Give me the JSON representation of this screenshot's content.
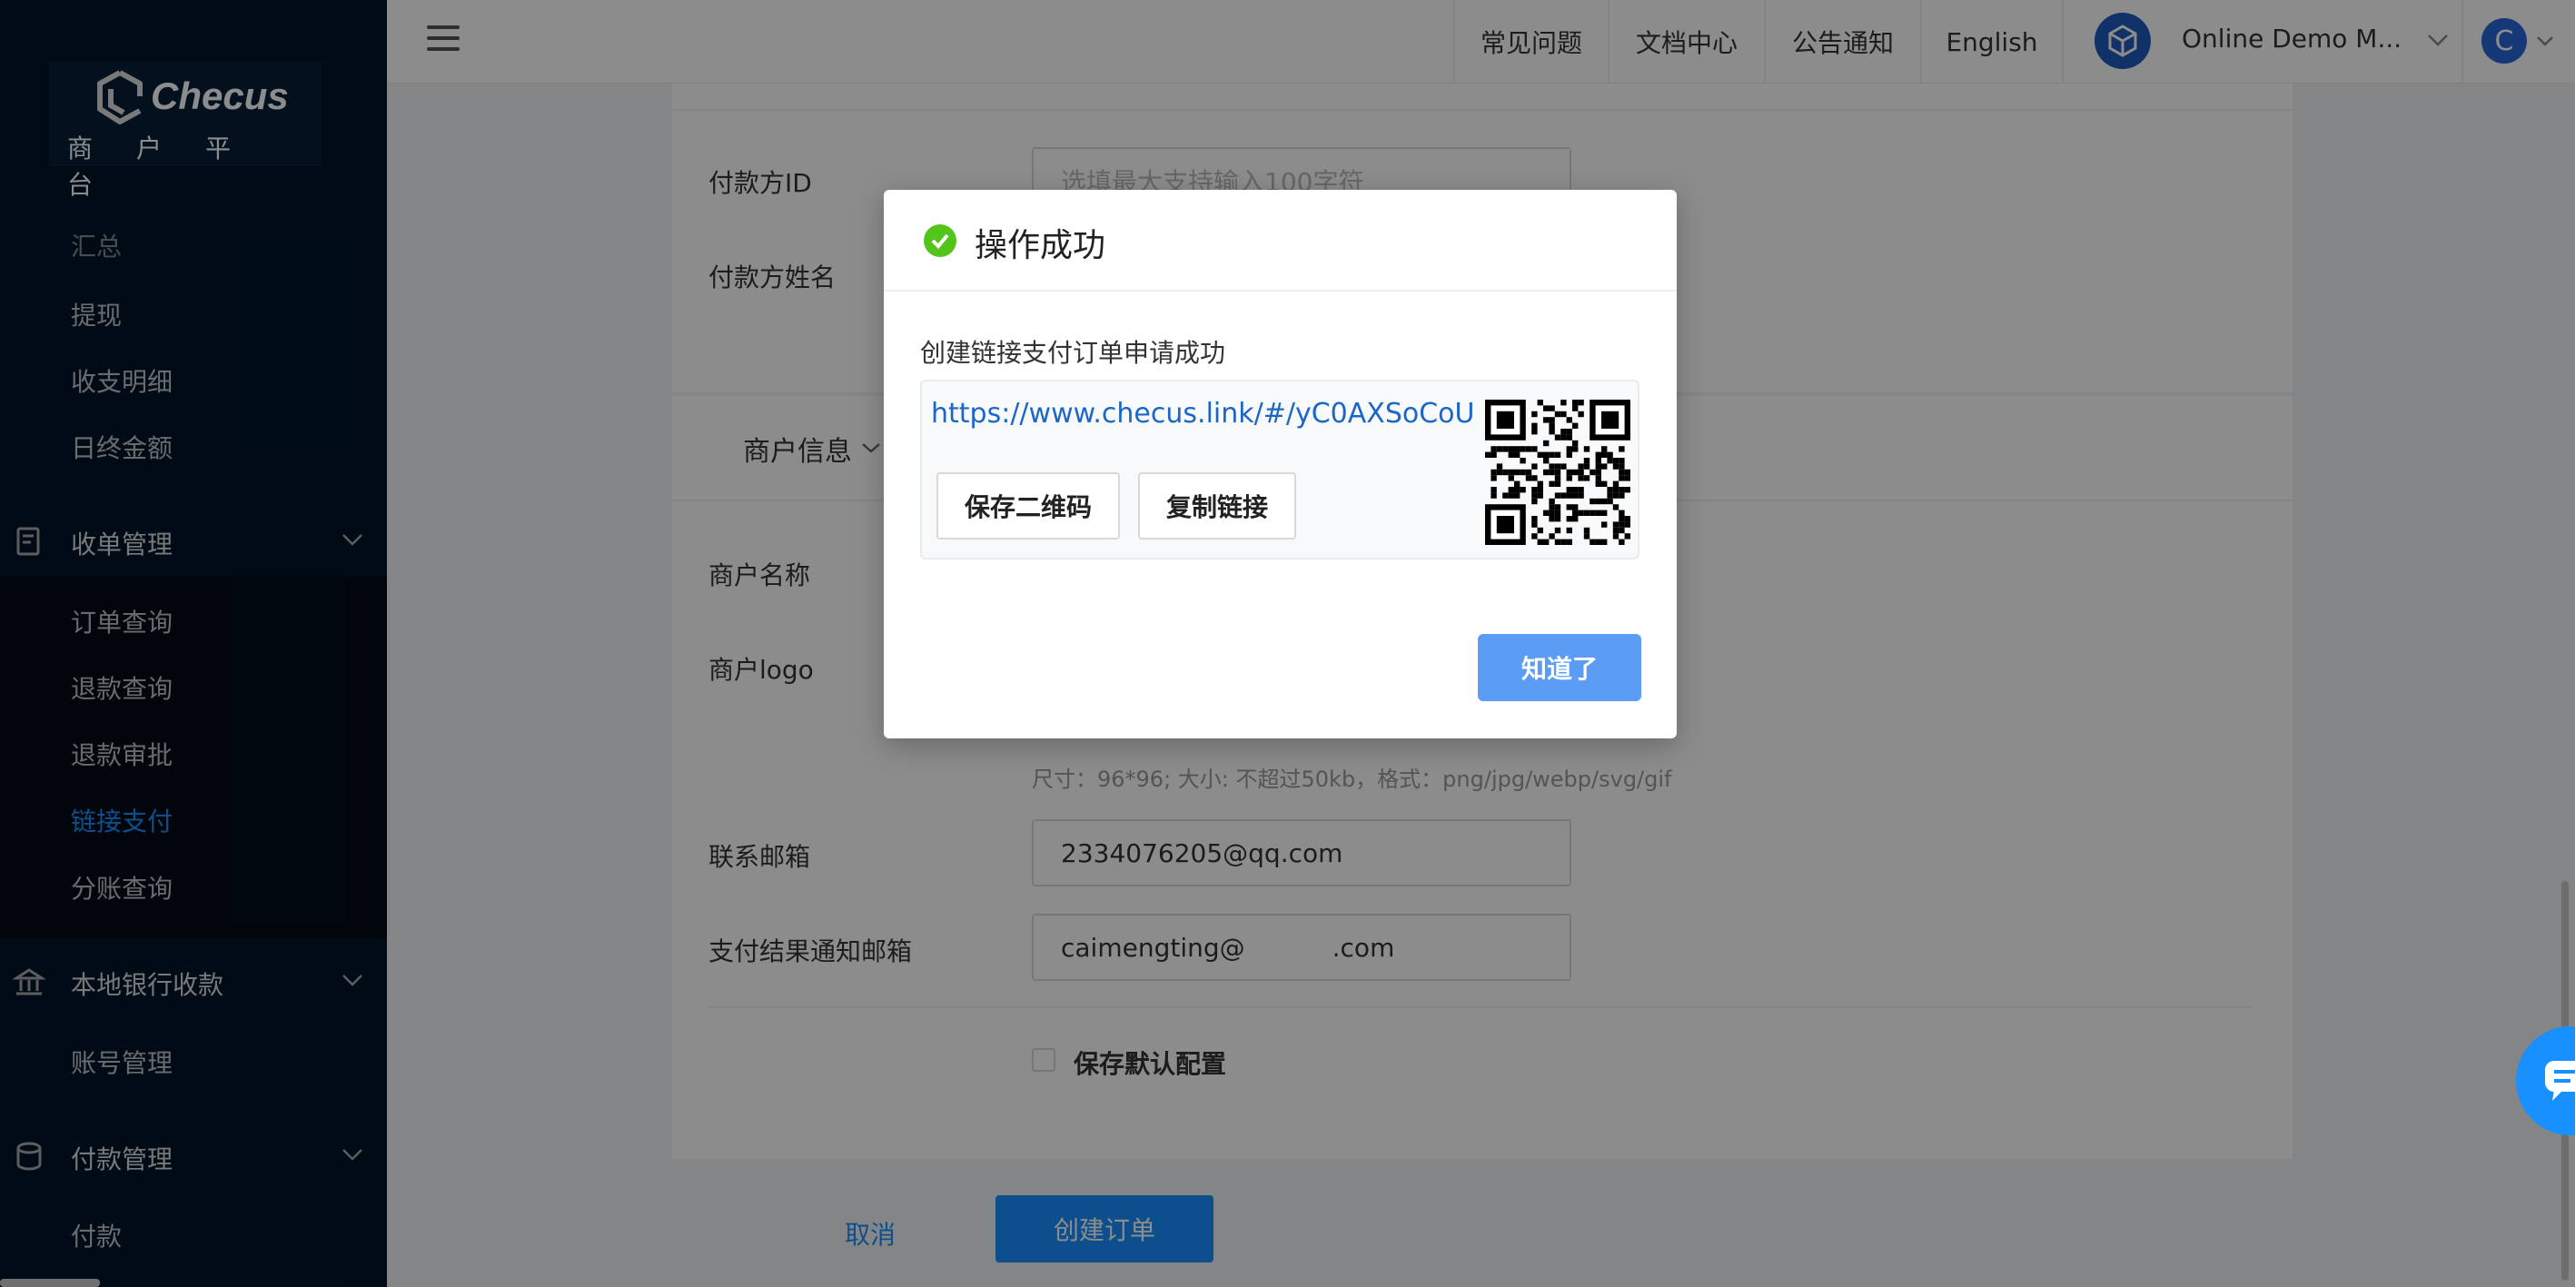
{
  "sidebar": {
    "logo_text": "Checus",
    "logo_sub": "商户平台",
    "items_top": [
      "汇总",
      "提现",
      "收支明细",
      "日终金额"
    ],
    "group_collect": {
      "label": "收单管理",
      "icon": "receipt-icon"
    },
    "collect_items": [
      "订单查询",
      "退款查询",
      "退款审批",
      "链接支付",
      "分账查询"
    ],
    "active_item": "链接支付",
    "group_bank": {
      "label": "本地银行收款",
      "icon": "bank-icon"
    },
    "bank_items": [
      "账号管理"
    ],
    "group_pay": {
      "label": "付款管理",
      "icon": "database-icon"
    },
    "pay_items": [
      "付款"
    ]
  },
  "header": {
    "nav": [
      "常见问题",
      "文档中心",
      "公告通知",
      "English"
    ],
    "merchant": "Online Demo M...",
    "user_initial": "C"
  },
  "form": {
    "payer_id_label": "付款方ID",
    "payer_id_placeholder": "选填最大支持输入100字符",
    "payer_name_label": "付款方姓名",
    "merchant_section": "商户信息",
    "merchant_name_label": "商户名称",
    "merchant_logo_label": "商户logo",
    "logo_hint": "尺寸：96*96; 大小: 不超过50kb，格式：png/jpg/webp/svg/gif",
    "email_label": "联系邮箱",
    "email_value": "2334076205@qq.com",
    "notify_email_label": "支付结果通知邮箱",
    "notify_email_value_start": "caimengting@",
    "notify_email_value_end": ".com",
    "save_default_label": "保存默认配置",
    "cancel_label": "取消",
    "create_label": "创建订单"
  },
  "modal": {
    "title": "操作成功",
    "message": "创建链接支付订单申请成功",
    "url": "https://www.checus.link/#/yC0AXSoCoU",
    "save_qr_label": "保存二维码",
    "copy_link_label": "复制链接",
    "ok_label": "知道了"
  },
  "colors": {
    "primary": "#1890ff",
    "success": "#52c41a",
    "sidebar": "#001529"
  }
}
